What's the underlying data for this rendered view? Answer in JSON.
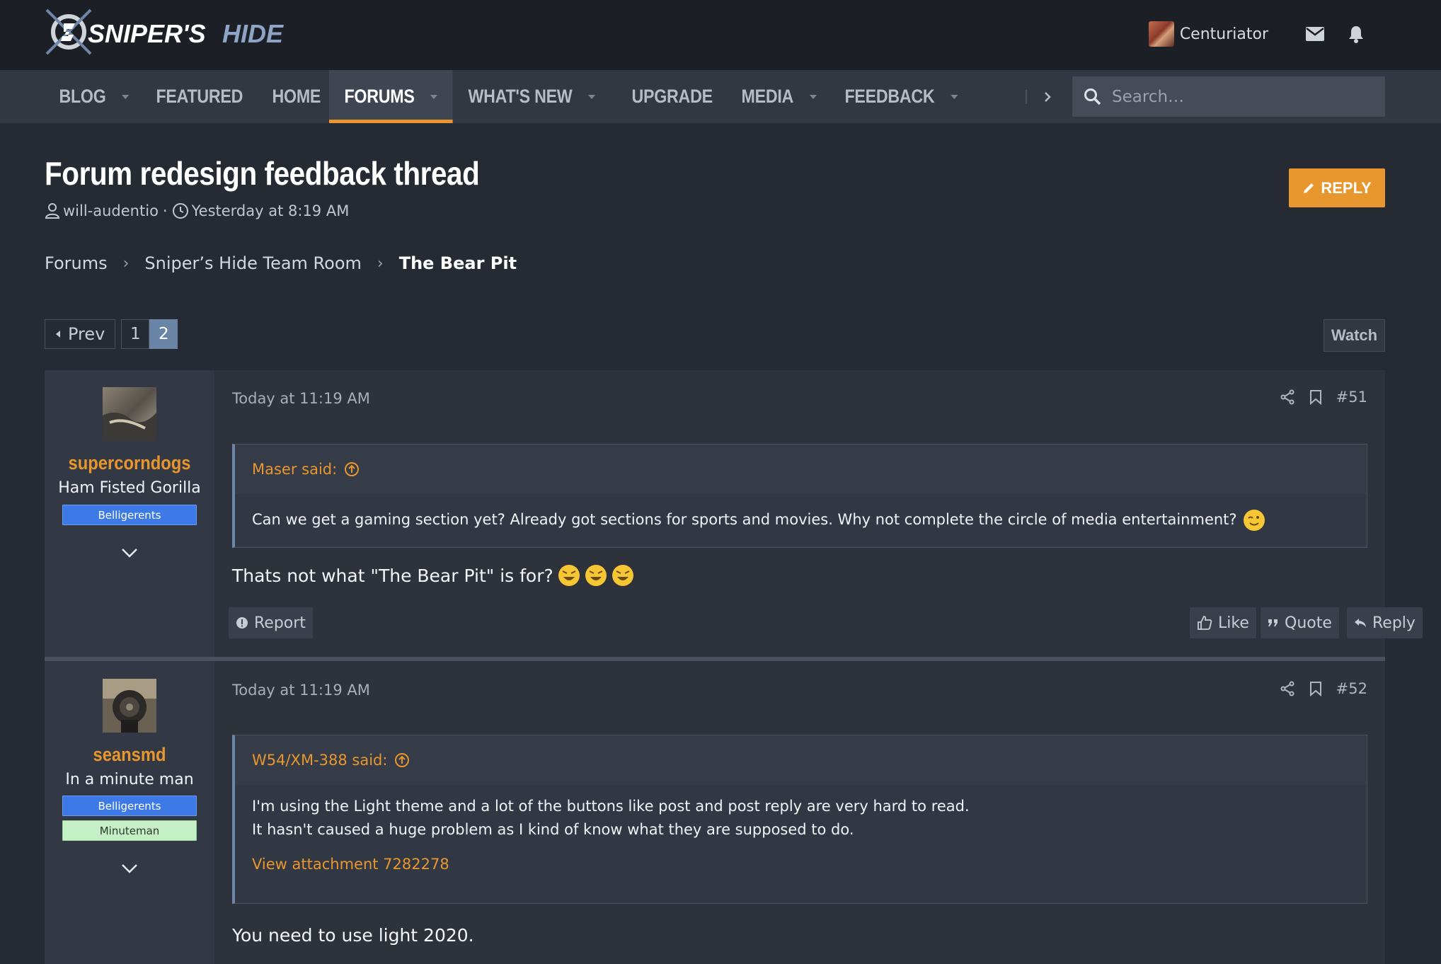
{
  "site": {
    "logo_text_a": "SNIPER'S",
    "logo_text_b": "HIDE"
  },
  "header": {
    "username": "Centuriator"
  },
  "nav": {
    "items": [
      {
        "label": "BLOG",
        "dropdown": true
      },
      {
        "label": "FEATURED",
        "dropdown": false
      },
      {
        "label": "HOME",
        "dropdown": false
      },
      {
        "label": "FORUMS",
        "dropdown": true,
        "active": true
      },
      {
        "label": "WHAT'S NEW",
        "dropdown": true
      },
      {
        "label": "UPGRADE",
        "dropdown": false
      },
      {
        "label": "MEDIA",
        "dropdown": true
      },
      {
        "label": "FEEDBACK",
        "dropdown": true
      }
    ],
    "search_placeholder": "Search…"
  },
  "thread": {
    "title": "Forum redesign feedback thread",
    "author": "will-audentio",
    "meta_sep": "·",
    "date": "Yesterday at 8:19 AM",
    "reply_label": "REPLY"
  },
  "breadcrumb": [
    "Forums",
    "Sniper’s Hide Team Room",
    "The Bear Pit"
  ],
  "pager": {
    "prev_label": "Prev",
    "pages": [
      "1",
      "2"
    ],
    "current": "2",
    "watch_label": "Watch"
  },
  "posts": [
    {
      "username": "supercorndogs",
      "user_title": "Ham Fisted Gorilla",
      "banners": [
        "Belligerents"
      ],
      "date": "Today at 11:19 AM",
      "number": "#51",
      "quote_author": "Maser said:",
      "quote_lines": [
        "Can we get a gaming section yet? Already got sections for sports and movies. Why not complete the circle of media entertainment?"
      ],
      "text": "Thats not what \"The Bear Pit\" is for?",
      "report_label": "Report",
      "like_label": "Like",
      "quote_label": "Quote",
      "reply_label": "Reply"
    },
    {
      "username": "seansmd",
      "user_title": "In a minute man",
      "banners": [
        "Belligerents",
        "Minuteman"
      ],
      "date": "Today at 11:19 AM",
      "number": "#52",
      "quote_author": "W54/XM-388 said:",
      "quote_lines": [
        "I'm using the Light theme and a lot of the buttons like post and post reply are very hard to read.",
        "It hasn't caused a huge problem as I kind of know what they are supposed to do."
      ],
      "quote_attachment": "View attachment 7282278",
      "text": "You need to use light 2020."
    }
  ],
  "colors": {
    "accent": "#e8962e",
    "background": "#252a33",
    "header": "#1c1f26",
    "nav": "#323842",
    "banner_blue": "#3d7ae8",
    "banner_green": "#c5f0c5"
  },
  "icons": [
    "logo-icon",
    "mail-icon",
    "bell-icon",
    "search-icon",
    "pencil-icon",
    "user-icon",
    "clock-icon",
    "share-icon",
    "bookmark-icon",
    "arrow-up-circle-icon",
    "chevron-down-icon",
    "report-icon",
    "thumbs-up-icon",
    "quote-icon",
    "reply-icon"
  ]
}
